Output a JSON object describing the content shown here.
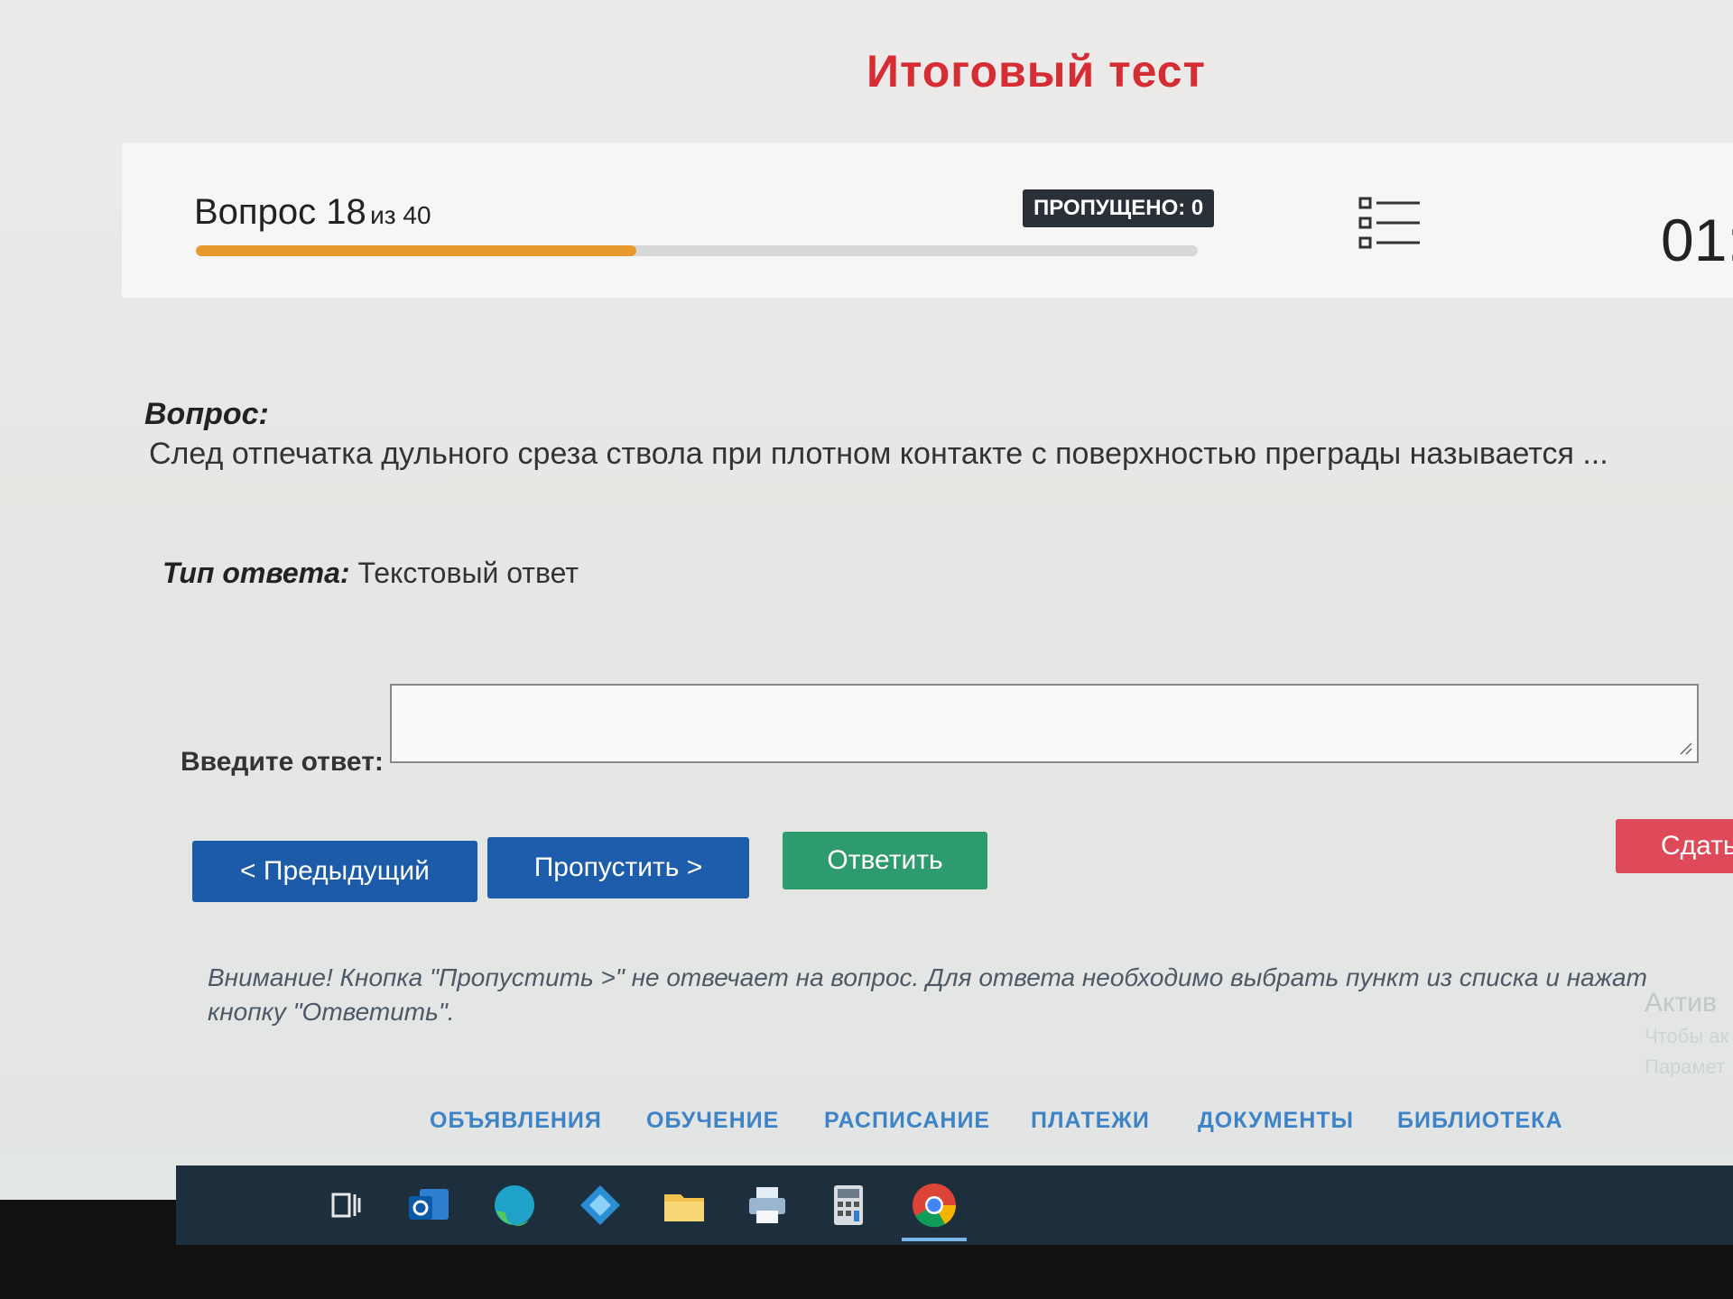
{
  "page": {
    "title": "Итоговый тест"
  },
  "progress": {
    "question_label": "Вопрос 18",
    "question_total": "из 40",
    "current": 18,
    "total": 40,
    "fraction": 0.44,
    "skipped_badge": "ПРОПУЩЕНО: 0",
    "timer": "01:"
  },
  "question": {
    "label": "Вопрос:",
    "text": "След отпечатка дульного среза ствола при плотном контакте с поверхностью преграды называется ...",
    "answer_type_label": "Тип ответа:",
    "answer_type_value": "Текстовый ответ",
    "input_label": "Введите ответ:",
    "input_value": ""
  },
  "buttons": {
    "prev": "< Предыдущий",
    "skip": "Пропустить >",
    "answer": "Ответить",
    "submit": "Сдать т"
  },
  "notice": {
    "line1": "Внимание! Кнопка \"Пропустить >\" не отвечает на вопрос. Для ответа необходимо выбрать пункт из списка и нажат",
    "line2": "кнопку \"Ответить\"."
  },
  "watermark": {
    "line1": "Актив",
    "line2": "Чтобы ак",
    "line3": "Парамет"
  },
  "footer": {
    "links": [
      "ОБЪЯВЛЕНИЯ",
      "ОБУЧЕНИЕ",
      "РАСПИСАНИЕ",
      "ПЛАТЕЖИ",
      "ДОКУМЕНТЫ",
      "БИБЛИОТЕКА"
    ]
  },
  "taskbar": {
    "icons": [
      "task-view-icon",
      "outlook-icon",
      "edge-icon",
      "kodi-icon",
      "file-explorer-icon",
      "printer-icon",
      "calculator-icon",
      "chrome-icon"
    ]
  },
  "colors": {
    "title_red": "#d62d35",
    "progress_orange": "#e99a2d",
    "button_blue": "#1c5ba8",
    "button_green": "#2e9b6c",
    "button_red": "#de4a5a",
    "link_blue": "#3d83c6"
  }
}
